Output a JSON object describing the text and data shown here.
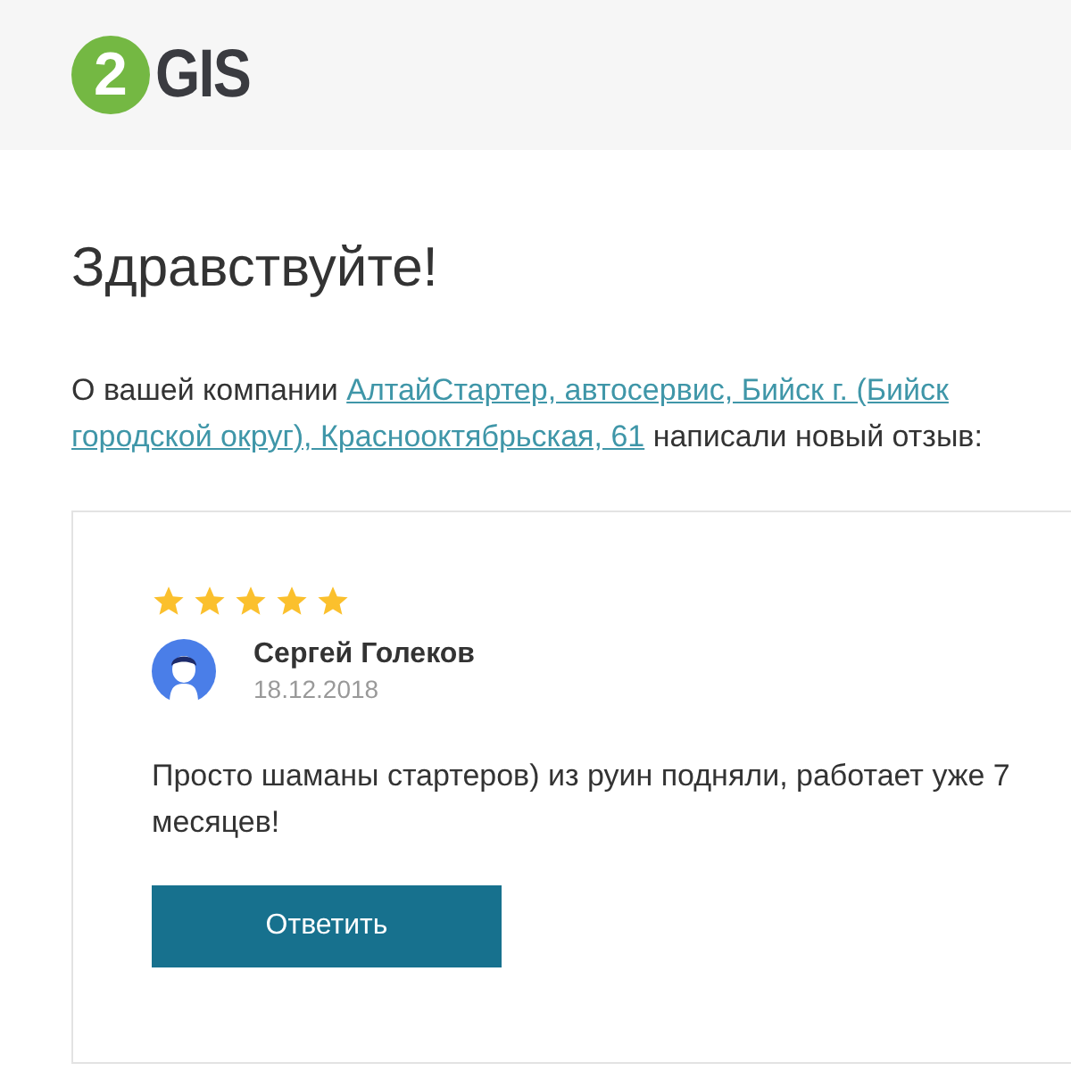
{
  "logo": {
    "mark": "2",
    "word": "GIS"
  },
  "greeting": "Здравствуйте!",
  "intro": {
    "before": "О вашей компании",
    "link_lines": [
      "АлтайСтартер, автосервис, Бийск г. (Бийск",
      "городской округ), Краснооктябрьская, 61"
    ],
    "after": "написали новый отзыв:"
  },
  "review": {
    "stars": 5,
    "author": "Сергей Голеков",
    "date": "18.12.2018",
    "text": "Просто шаманы стартеров) из руин подняли, работает уже 7 месяцев!",
    "button": "Ответить"
  }
}
